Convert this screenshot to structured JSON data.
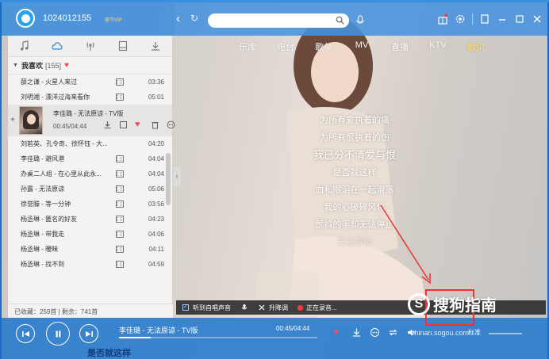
{
  "header": {
    "username": "1024012155",
    "vip_label": "豪华VIP",
    "search_value": ""
  },
  "nav_tabs": [
    {
      "label": "乐库",
      "active": false
    },
    {
      "label": "电台",
      "active": false
    },
    {
      "label": "歌单",
      "active": false
    },
    {
      "label": "MV",
      "active": false
    },
    {
      "label": "直播",
      "active": false
    },
    {
      "label": "KTV",
      "active": false
    },
    {
      "label": "歌词",
      "active": true
    }
  ],
  "left_tabs": [
    "music-note-icon",
    "cloud-icon",
    "radio-icon",
    "device-icon",
    "download-icon"
  ],
  "playlist": {
    "title": "我喜欢",
    "count": "[155]"
  },
  "songs_before": [
    {
      "name": "薛之谦 - 火星人来过",
      "duration": "03:36"
    },
    {
      "name": "刘明湘 - 漂洋过海来看你",
      "duration": "05:01"
    }
  ],
  "playing": {
    "name": "李佳璐 - 无法原谅 - TV版",
    "time": "00:45/04:44"
  },
  "songs_after": [
    {
      "name": "刘若英、孔令奇、徐怀钰 - 大...",
      "duration": "04:20"
    },
    {
      "name": "李佳璐 - 避风港",
      "duration": "04:04"
    },
    {
      "name": "办桌二人组 - 在心里从此永...",
      "duration": "04:04"
    },
    {
      "name": "孙露 - 无法原谅",
      "duration": "05:06"
    },
    {
      "name": "徐誉滕 - 等一分钟",
      "duration": "03:56"
    },
    {
      "name": "杨丞琳 - 匿名的好友",
      "duration": "04:23"
    },
    {
      "name": "杨丞琳 - 带我走",
      "duration": "04:06"
    },
    {
      "name": "杨丞琳 - 暧昧",
      "duration": "04:11"
    },
    {
      "name": "杨丞琳 - 找不到",
      "duration": "04:59"
    }
  ],
  "left_footer": {
    "collected": "已收藏：259首",
    "remaining": "剩余：741首"
  },
  "lyrics": [
    {
      "text": "为所有爱执着的痛",
      "style": "normal"
    },
    {
      "text": "为所有恨执着的伤",
      "style": "normal"
    },
    {
      "text": "我已分不清爱与恨",
      "style": "current"
    },
    {
      "text": "是否就这样",
      "style": "normal"
    },
    {
      "text": "血和眼泪在一起滑落",
      "style": "normal"
    },
    {
      "text": "我的心破碎风化",
      "style": "normal"
    },
    {
      "text": "颤抖的手却无法停止",
      "style": "normal"
    },
    {
      "text": "无法原谅",
      "style": "dim"
    }
  ],
  "record_bar": {
    "listen": "听到自唱声音",
    "pitch": "升降调",
    "recording": "正在录音..."
  },
  "player": {
    "title": "李佳璐 - 无法原谅 - TV版",
    "time": "00:45/04:44",
    "progress": 0.158,
    "bottom_lyric": "是否就这样",
    "quality_label": "标准"
  },
  "watermark": {
    "logo_text": "S",
    "brand": "搜狗指南",
    "url": "zhinan.sogou.com"
  },
  "colors": {
    "header_blue": "#3c8cdc",
    "player_blue": "#2d7dcd",
    "accent_yellow": "#ffe66b",
    "heart_red": "#ee4d5e",
    "highlight_red": "#ee3333"
  }
}
